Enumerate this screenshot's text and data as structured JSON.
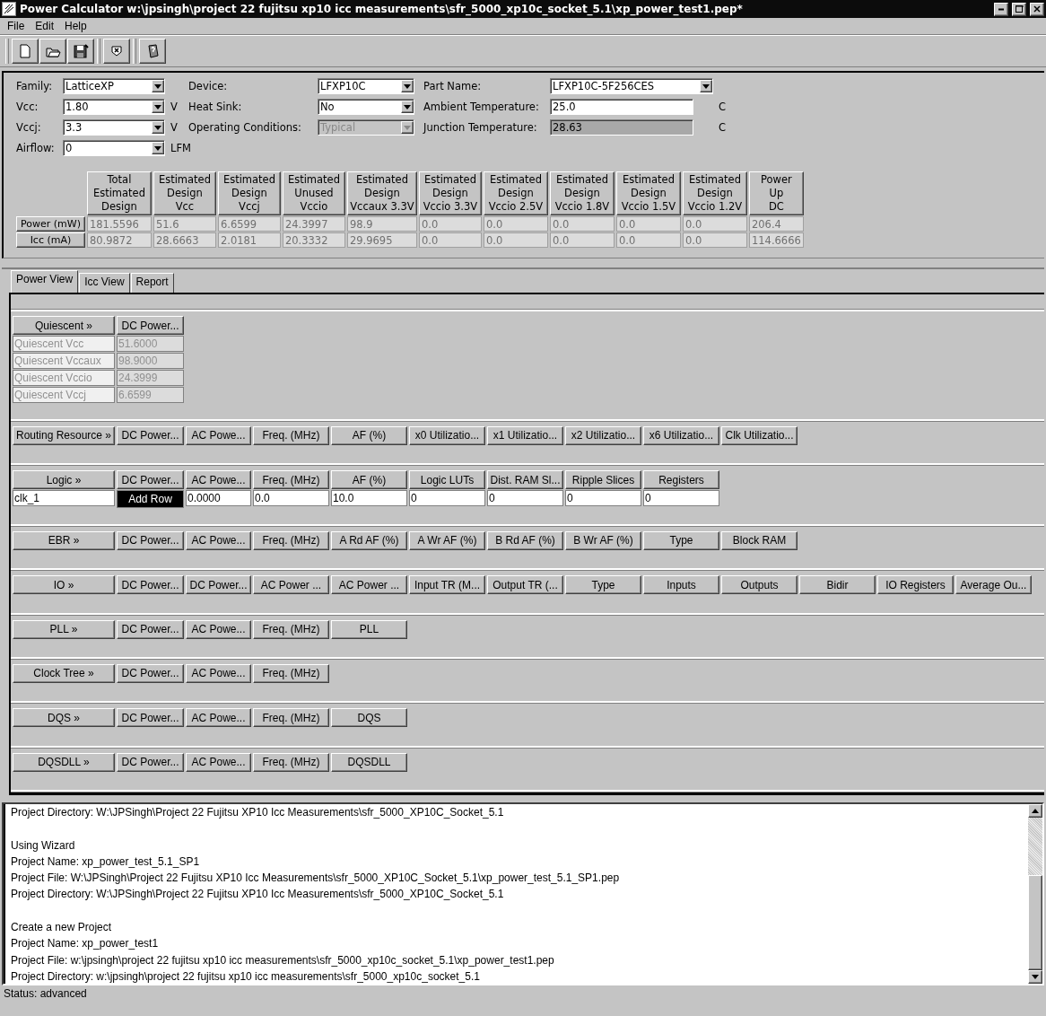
{
  "window": {
    "title": "Power Calculator  w:\\jpsingh\\project 22 fujitsu xp10 icc measurements\\sfr_5000_xp10c_socket_5.1\\xp_power_test1.pep*"
  },
  "menu": [
    "File",
    "Edit",
    "Help"
  ],
  "settings": {
    "rows": [
      [
        {
          "label": "Family:",
          "value": "LatticeXP",
          "kind": "dropdown",
          "disabled": false
        },
        {
          "label": "Device:",
          "value": "LFXP10C",
          "kind": "dropdown",
          "disabled": false
        },
        {
          "label": "Part Name:",
          "value": "LFXP10C-5F256CES",
          "kind": "dropdown",
          "disabled": false
        }
      ],
      [
        {
          "label": "Vcc:",
          "value": "1.80",
          "kind": "dropdown",
          "disabled": false,
          "unit": "V"
        },
        {
          "label": "Heat Sink:",
          "value": "No",
          "kind": "dropdown",
          "disabled": false
        },
        {
          "label": "Ambient Temperature:",
          "value": "25.0",
          "kind": "text",
          "disabled": false,
          "unit": "C"
        }
      ],
      [
        {
          "label": "Vccj:",
          "value": "3.3",
          "kind": "dropdown",
          "disabled": false,
          "unit": "V"
        },
        {
          "label": "Operating Conditions:",
          "value": "Typical",
          "kind": "dropdown",
          "disabled": true
        },
        {
          "label": "Junction Temperature:",
          "value": "28.63",
          "kind": "text",
          "disabled": true,
          "unit": "C"
        }
      ],
      [
        {
          "label": "Airflow:",
          "value": "0",
          "kind": "dropdown",
          "disabled": false,
          "unit": "LFM"
        }
      ]
    ]
  },
  "summary": {
    "columns": [
      "Total\nEstimated\nDesign",
      "Estimated\nDesign\nVcc",
      "Estimated\nDesign\nVccj",
      "Estimated\nUnused\nVccio",
      "Estimated\nDesign\nVccaux 3.3V",
      "Estimated\nDesign\nVccio 3.3V",
      "Estimated\nDesign\nVccio 2.5V",
      "Estimated\nDesign\nVccio 1.8V",
      "Estimated\nDesign\nVccio 1.5V",
      "Estimated\nDesign\nVccio 1.2V",
      "Power\nUp\nDC"
    ],
    "rows": [
      {
        "label": "Power (mW)",
        "cells": [
          "181.5596",
          "51.6",
          "6.6599",
          "24.3997",
          "98.9",
          "0.0",
          "0.0",
          "0.0",
          "0.0",
          "0.0",
          "206.4"
        ]
      },
      {
        "label": "Icc (mA)",
        "cells": [
          "80.9872",
          "28.6663",
          "2.0181",
          "20.3332",
          "29.9695",
          "0.0",
          "0.0",
          "0.0",
          "0.0",
          "0.0",
          "114.6666"
        ]
      }
    ]
  },
  "tabs": [
    {
      "label": "Power View",
      "selected": true
    },
    {
      "label": "Icc View",
      "selected": false
    },
    {
      "label": "Report",
      "selected": false
    }
  ],
  "sections": [
    {
      "headers": [
        "Quiescent »",
        "DC Power..."
      ],
      "rows": [
        {
          "cells": [
            "Quiescent Vcc",
            "51.6000"
          ],
          "disabled": true
        },
        {
          "cells": [
            "Quiescent Vccaux",
            "98.9000"
          ],
          "disabled": true
        },
        {
          "cells": [
            "Quiescent Vccio",
            "24.3999"
          ],
          "disabled": true
        },
        {
          "cells": [
            "Quiescent Vccj",
            "6.6599"
          ],
          "disabled": true
        }
      ]
    },
    {
      "headers": [
        "Routing Resource »",
        "DC Power...",
        "AC Powe...",
        "Freq. (MHz)",
        "AF (%)",
        "x0 Utilizatio...",
        "x1 Utilizatio...",
        "x2 Utilizatio...",
        "x6 Utilizatio...",
        "Clk Utilizatio..."
      ]
    },
    {
      "headers": [
        "Logic »",
        "DC Power...",
        "AC Powe...",
        "Freq. (MHz)",
        "AF (%)",
        "Logic LUTs",
        "Dist. RAM Sl...",
        "Ripple Slices",
        "Registers"
      ],
      "rows": [
        {
          "cells": [
            "clk_1",
            null,
            "0.0000",
            "0.0",
            "10.0",
            "0",
            "0",
            "0",
            "0"
          ],
          "disabled": false
        }
      ],
      "context_menu": [
        "Add Row"
      ]
    },
    {
      "headers": [
        "EBR »",
        "DC Power...",
        "AC Powe...",
        "Freq. (MHz)",
        "A Rd AF (%)",
        "A Wr AF (%)",
        "B Rd AF (%)",
        "B Wr AF (%)",
        "Type",
        "Block RAM"
      ]
    },
    {
      "headers": [
        "IO »",
        "DC Power...",
        "DC Power...",
        "AC Power ...",
        "AC Power ...",
        "Input TR (M...",
        "Output TR (...",
        "Type",
        "Inputs",
        "Outputs",
        "Bidir",
        "IO Registers",
        "Average Ou..."
      ]
    },
    {
      "headers": [
        "PLL »",
        "DC Power...",
        "AC Powe...",
        "Freq. (MHz)",
        "PLL"
      ]
    },
    {
      "headers": [
        "Clock Tree »",
        "DC Power...",
        "AC Powe...",
        "Freq. (MHz)"
      ]
    },
    {
      "headers": [
        "DQS »",
        "DC Power...",
        "AC Powe...",
        "Freq. (MHz)",
        "DQS"
      ]
    },
    {
      "headers": [
        "DQSDLL »",
        "DC Power...",
        "AC Powe...",
        "Freq. (MHz)",
        "DQSDLL"
      ]
    }
  ],
  "log": [
    [
      "Project Directory: W:\\JPSingh\\Project 22 Fujitsu XP10 Icc Measurements\\sfr_5000_XP10C_Socket_5.1"
    ],
    [
      "Using Wizard",
      "Project Name: xp_power_test_5.1_SP1",
      "Project File: W:\\JPSingh\\Project 22 Fujitsu XP10 Icc Measurements\\sfr_5000_XP10C_Socket_5.1\\xp_power_test_5.1_SP1.pep",
      "Project Directory: W:\\JPSingh\\Project 22 Fujitsu XP10 Icc Measurements\\sfr_5000_XP10C_Socket_5.1"
    ],
    [
      "Create a new Project",
      "Project Name: xp_power_test1",
      "Project File: w:\\jpsingh\\project 22 fujitsu xp10 icc measurements\\sfr_5000_xp10c_socket_5.1\\xp_power_test1.pep",
      "Project Directory: w:\\jpsingh\\project 22 fujitsu xp10 icc measurements\\sfr_5000_xp10c_socket_5.1"
    ]
  ],
  "status_bar": "Status: advanced"
}
